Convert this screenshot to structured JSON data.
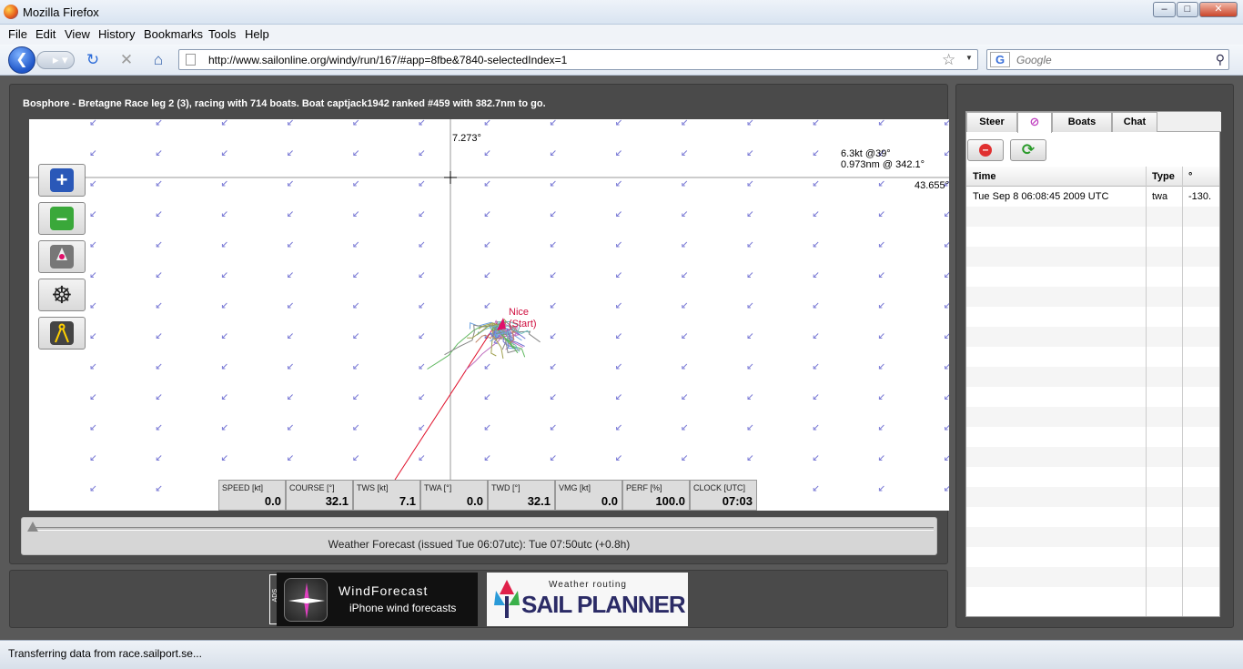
{
  "window": {
    "title": "Mozilla Firefox"
  },
  "menu": [
    "File",
    "Edit",
    "View",
    "History",
    "Bookmarks",
    "Tools",
    "Help"
  ],
  "nav": {
    "url": "http://www.sailonline.org/windy/run/167/#app=8fbe&7840-selectedIndex=1",
    "search_placeholder": "Google"
  },
  "race": {
    "status": "Bosphore - Bretagne Race leg 2 (3), racing with 714 boats. Boat captjack1942 ranked #459 with 382.7nm to go."
  },
  "map": {
    "lon_readout": "7.273°",
    "lat_readout": "43.655°",
    "wind_readout": "6.3kt @39°",
    "distance_readout": "0.973nm @ 342.1°",
    "start_label_1": "Nice",
    "start_label_2": "(Start)",
    "tools": [
      {
        "name": "zoom-in-icon"
      },
      {
        "name": "zoom-out-icon"
      },
      {
        "name": "center-boat-icon"
      },
      {
        "name": "helm-icon"
      },
      {
        "name": "measure-icon"
      }
    ]
  },
  "instruments": [
    {
      "label": "SPEED [kt]",
      "value": "0.0"
    },
    {
      "label": "COURSE [°]",
      "value": "32.1"
    },
    {
      "label": "TWS [kt]",
      "value": "7.1"
    },
    {
      "label": "TWA [°]",
      "value": "0.0"
    },
    {
      "label": "TWD [°]",
      "value": "32.1"
    },
    {
      "label": "VMG [kt]",
      "value": "0.0"
    },
    {
      "label": "PERF [%]",
      "value": "100.0"
    },
    {
      "label": "CLOCK [UTC]",
      "value": "07:03"
    }
  ],
  "forecast": {
    "text": "Weather Forecast  (issued Tue 06:07utc): Tue 07:50utc  (+0.8h)",
    "slider_position": 0.0
  },
  "ads": {
    "label": "ADS",
    "wind_title": "WindForecast",
    "wind_subtitle": "iPhone wind forecasts",
    "sail_title": "Weather routing",
    "sail_name": "SAIL PLANNER"
  },
  "side": {
    "tabs": [
      "Steer",
      "",
      "Boats",
      "Chat"
    ],
    "columns": [
      "Time",
      "Type",
      "°"
    ],
    "rows": [
      [
        "Tue Sep 8 06:08:45 2009 UTC",
        "twa",
        "-130."
      ]
    ]
  },
  "status": {
    "text": "Transferring data from race.sailport.se..."
  },
  "colors": {
    "panel": "#4a4a4a",
    "start": "#d01040",
    "arrow": "#7b7bd6"
  }
}
